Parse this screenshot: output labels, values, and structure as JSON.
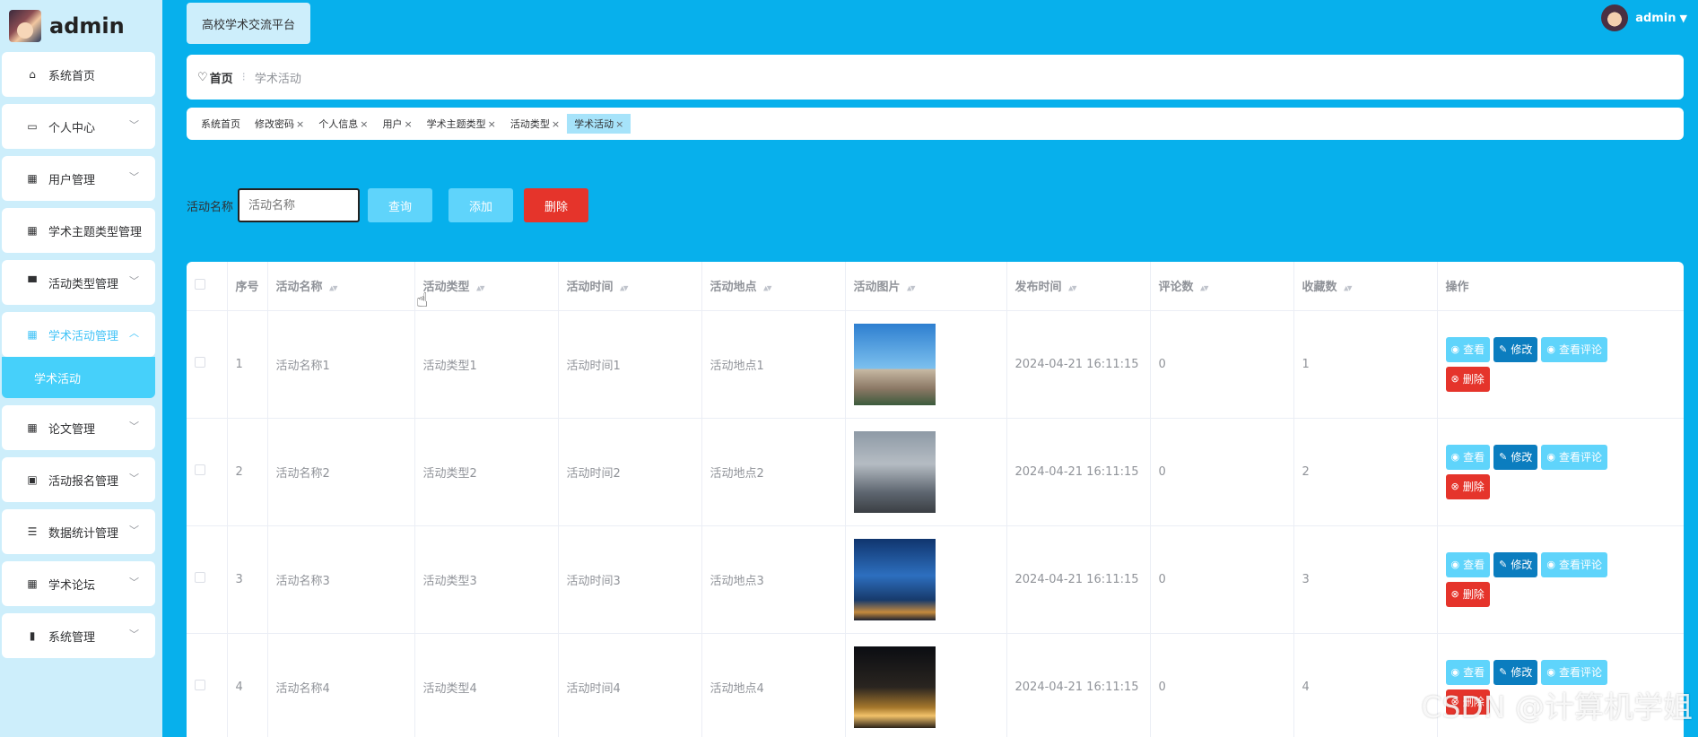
{
  "sidebar": {
    "brand": "admin",
    "items": [
      {
        "label": "系统首页",
        "icon": "home-icon",
        "glyph": "⌂",
        "chevron": false
      },
      {
        "label": "个人中心",
        "icon": "user-card-icon",
        "glyph": "▭",
        "chevron": true
      },
      {
        "label": "用户管理",
        "icon": "grid-icon",
        "glyph": "▦",
        "chevron": true
      },
      {
        "label": "学术主题类型管理",
        "icon": "grid-icon",
        "glyph": "▦",
        "chevron": false
      },
      {
        "label": "活动类型管理",
        "icon": "brush-icon",
        "glyph": "▀",
        "chevron": true
      },
      {
        "label": "学术活动管理",
        "icon": "grid-icon",
        "glyph": "▦",
        "chevron": true,
        "active": true,
        "sub": "学术活动"
      },
      {
        "label": "论文管理",
        "icon": "grid-icon",
        "glyph": "▦",
        "chevron": true
      },
      {
        "label": "活动报名管理",
        "icon": "clipboard-icon",
        "glyph": "▣",
        "chevron": true
      },
      {
        "label": "数据统计管理",
        "icon": "list-icon",
        "glyph": "☰",
        "chevron": true
      },
      {
        "label": "学术论坛",
        "icon": "grid-icon",
        "glyph": "▦",
        "chevron": true
      },
      {
        "label": "系统管理",
        "icon": "bar-chart-icon",
        "glyph": "▮",
        "chevron": true
      }
    ]
  },
  "header": {
    "platform": "高校学术交流平台",
    "user": "admin"
  },
  "breadcrumb": {
    "home": "首页",
    "current": "学术活动"
  },
  "tags": [
    {
      "label": "系统首页",
      "close": false
    },
    {
      "label": "修改密码",
      "close": true
    },
    {
      "label": "个人信息",
      "close": true
    },
    {
      "label": "用户",
      "close": true
    },
    {
      "label": "学术主题类型",
      "close": true
    },
    {
      "label": "活动类型",
      "close": true
    },
    {
      "label": "学术活动",
      "close": true,
      "active": true
    }
  ],
  "search": {
    "label": "活动名称",
    "placeholder": "活动名称",
    "query_btn": "查询",
    "add_btn": "添加",
    "delete_btn": "删除"
  },
  "table": {
    "columns": [
      "序号",
      "活动名称",
      "活动类型",
      "活动时间",
      "活动地点",
      "活动图片",
      "发布时间",
      "评论数",
      "收藏数",
      "操作"
    ],
    "rows": [
      {
        "no": "1",
        "name": "活动名称1",
        "type": "活动类型1",
        "time": "活动时间1",
        "place": "活动地点1",
        "pub": "2024-04-21 16:11:15",
        "comments": "0",
        "favs": "1"
      },
      {
        "no": "2",
        "name": "活动名称2",
        "type": "活动类型2",
        "time": "活动时间2",
        "place": "活动地点2",
        "pub": "2024-04-21 16:11:15",
        "comments": "0",
        "favs": "2"
      },
      {
        "no": "3",
        "name": "活动名称3",
        "type": "活动类型3",
        "time": "活动时间3",
        "place": "活动地点3",
        "pub": "2024-04-21 16:11:15",
        "comments": "0",
        "favs": "3"
      },
      {
        "no": "4",
        "name": "活动名称4",
        "type": "活动类型4",
        "time": "活动时间4",
        "place": "活动地点4",
        "pub": "2024-04-21 16:11:15",
        "comments": "0",
        "favs": "4"
      }
    ],
    "actions": {
      "view": "查看",
      "edit": "修改",
      "comments": "查看评论",
      "delete": "删除"
    }
  },
  "watermark": "CSDN @计算机学姐"
}
